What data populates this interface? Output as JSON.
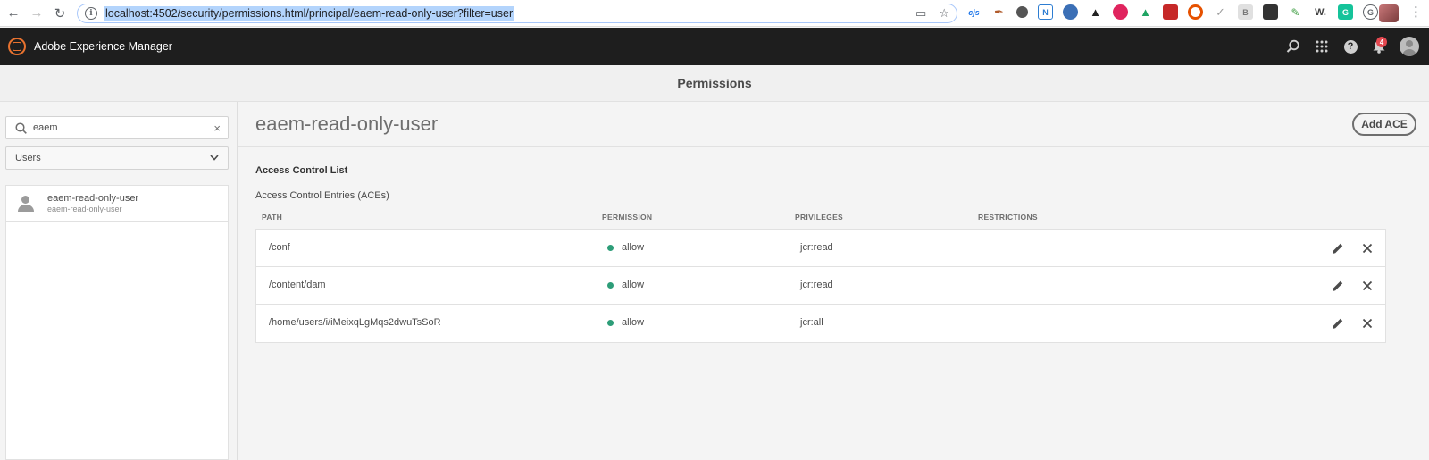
{
  "browser": {
    "url": "localhost:4502/security/permissions.html/principal/eaem-read-only-user?filter=user",
    "extensions": [
      {
        "name": "cjs-ext",
        "label": "cjs",
        "color": "#1a73e8"
      },
      {
        "name": "pen-ext",
        "label": "",
        "color": "#b05a2a"
      },
      {
        "name": "globe-ext",
        "label": "",
        "color": "#555555"
      },
      {
        "name": "n-ext",
        "label": "N",
        "color": "#2d7dd2"
      },
      {
        "name": "feather-ext",
        "label": "",
        "color": "#3b6fb6"
      },
      {
        "name": "spy-ext",
        "label": "",
        "color": "#222222"
      },
      {
        "name": "eye-ext",
        "label": "",
        "color": "#e0245e"
      },
      {
        "name": "drive-ext",
        "label": "",
        "color": "#1fa463"
      },
      {
        "name": "red-ext",
        "label": "",
        "color": "#c62828"
      },
      {
        "name": "target-ext",
        "label": "",
        "color": "#e65100"
      },
      {
        "name": "check-ext",
        "label": "",
        "color": "#9e9e9e"
      },
      {
        "name": "b-ext",
        "label": "B",
        "color": "#bdbdbd"
      },
      {
        "name": "dark-ext",
        "label": "",
        "color": "#333333"
      },
      {
        "name": "green-ext",
        "label": "",
        "color": "#43a047"
      },
      {
        "name": "w-ext",
        "label": "W.",
        "color": "#424242"
      },
      {
        "name": "grammarly-ext",
        "label": "G",
        "color": "#15c39a"
      },
      {
        "name": "chrome-g-ext",
        "label": "G",
        "color": "#5f6368"
      }
    ]
  },
  "header": {
    "app_title": "Adobe Experience Manager",
    "notification_count": "4"
  },
  "titlebar": {
    "title": "Permissions"
  },
  "rail": {
    "search_value": "eaem",
    "filter_selected": "Users",
    "principals": [
      {
        "name": "eaem-read-only-user",
        "sub": "eaem-read-only-user"
      }
    ]
  },
  "main": {
    "principal_title": "eaem-read-only-user",
    "add_ace_label": "Add ACE",
    "acl_heading": "Access Control List",
    "aces_heading": "Access Control Entries (ACEs)",
    "columns": {
      "path": "PATH",
      "permission": "PERMISSION",
      "privileges": "PRIVILEGES",
      "restrictions": "RESTRICTIONS"
    },
    "rows": [
      {
        "path": "/conf",
        "permission": "allow",
        "privileges": "jcr:read",
        "restrictions": ""
      },
      {
        "path": "/content/dam",
        "permission": "allow",
        "privileges": "jcr:read",
        "restrictions": ""
      },
      {
        "path": "/home/users/i/iMeixqLgMqs2dwuTsSoR",
        "permission": "allow",
        "privileges": "jcr:all",
        "restrictions": ""
      }
    ]
  },
  "colors": {
    "header_bg": "#1e1e1e",
    "allow_dot": "#2d9d78",
    "badge": "#e34850"
  }
}
